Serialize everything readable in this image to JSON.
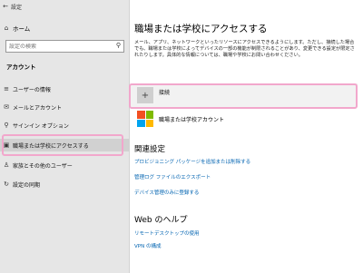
{
  "window": {
    "title": "設定",
    "back_glyph": "←"
  },
  "sidebar": {
    "home": {
      "label": "ホーム",
      "icon": "home-icon",
      "glyph": "⌂"
    },
    "search": {
      "placeholder": "設定の検索",
      "icon": "search-icon",
      "glyph": "⚲"
    },
    "section_title": "アカウント",
    "items": [
      {
        "label": "ユーザーの情報",
        "icon": "user-info-icon",
        "glyph": "≡"
      },
      {
        "label": "メールとアカウント",
        "icon": "mail-icon",
        "glyph": "✉"
      },
      {
        "label": "サインイン オプション",
        "icon": "key-icon",
        "glyph": "⚲"
      },
      {
        "label": "職場または学校にアクセスする",
        "icon": "briefcase-icon",
        "glyph": "▣"
      },
      {
        "label": "家族とその他のユーザー",
        "icon": "people-icon",
        "glyph": "♙"
      },
      {
        "label": "設定の同期",
        "icon": "sync-icon",
        "glyph": "↻"
      }
    ]
  },
  "main": {
    "title": "職場または学校にアクセスする",
    "description": "メール、アプリ、ネットワークといったリソースにアクセスできるようにします。ただし、接続した場合でも、職場または学校によってデバイスの一部の機能が制限されることがあり、変更できる設定が限定されたりします。具体的な情報については、職場や学校にお問い合わせください。",
    "connect": {
      "label": "接続",
      "glyph": "+"
    },
    "account": {
      "label": "職場または学校アカウント"
    },
    "related_title": "関連設定",
    "related_links": [
      "プロビジョニング パッケージを追加または削除する",
      "管理ログ ファイルのエクスポート",
      "デバイス管理のみに登録する"
    ],
    "help_title": "Web のヘルプ",
    "help_links": [
      "リモートデスクトップの使用",
      "VPN の構成"
    ]
  },
  "colors": {
    "link": "#0063b1",
    "highlight": "#f2a7cc",
    "ms_red": "#f25022",
    "ms_green": "#7fba00",
    "ms_blue": "#00a4ef",
    "ms_yellow": "#ffb900"
  }
}
